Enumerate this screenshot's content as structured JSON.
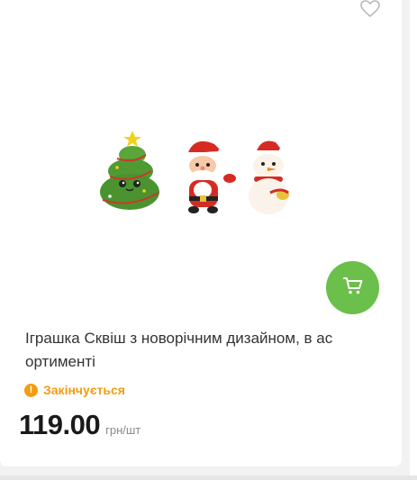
{
  "product": {
    "title": "Іграшка Сквіш з новорічним дизайном, в ас ортименті",
    "status": "Закінчується",
    "status_icon": "exclamation-icon",
    "price": "119.00",
    "unit": "грн/шт"
  },
  "icons": {
    "wishlist": "heart-outline-icon",
    "cart": "cart-icon"
  },
  "colors": {
    "accent_green": "#6bbf4b",
    "status_orange": "#f39c12",
    "price_text": "#1a1a1a",
    "unit_text": "#8a8a8a"
  }
}
